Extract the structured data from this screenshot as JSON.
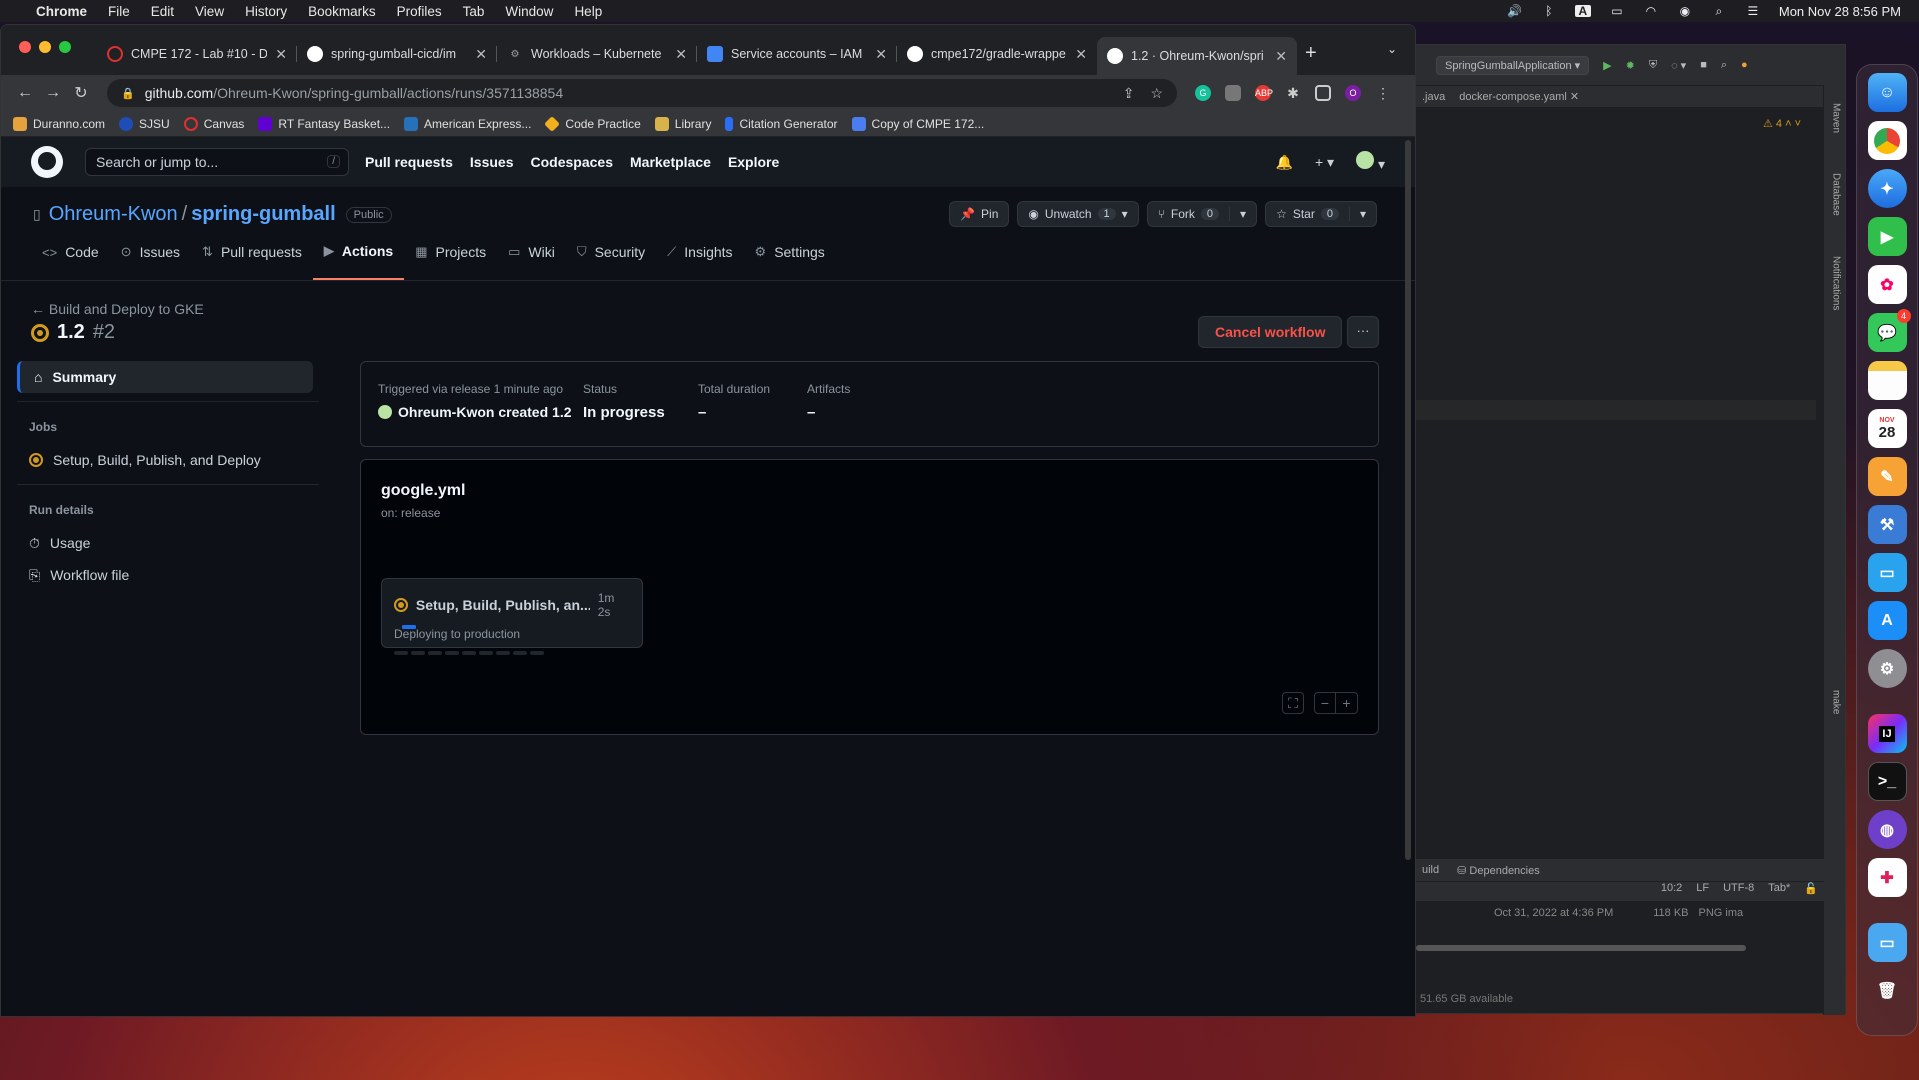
{
  "menubar": {
    "app": "Chrome",
    "items": [
      "File",
      "Edit",
      "View",
      "History",
      "Bookmarks",
      "Profiles",
      "Tab",
      "Window",
      "Help"
    ],
    "datetime": "Mon Nov 28  8:56 PM"
  },
  "browser": {
    "tabs": [
      {
        "title": "CMPE 172 - Lab #10 - D",
        "icon": "canvas-icon",
        "color": "#e0302f"
      },
      {
        "title": "spring-gumball-cicd/im",
        "icon": "github-icon",
        "color": "#ffffff"
      },
      {
        "title": "Workloads – Kubernete",
        "icon": "gear-icon",
        "color": "#9aa0a6"
      },
      {
        "title": "Service accounts – IAM",
        "icon": "shield-icon",
        "color": "#4285f4"
      },
      {
        "title": "cmpe172/gradle-wrappe",
        "icon": "github-icon",
        "color": "#ffffff"
      },
      {
        "title": "1.2 · Ohreum-Kwon/spri",
        "icon": "github-icon",
        "color": "#ffffff",
        "active": true
      }
    ],
    "url_host": "github.com",
    "url_path": "/Ohreum-Kwon/spring-gumball/actions/runs/3571138854",
    "bookmarks": [
      "Duranno.com",
      "SJSU",
      "Canvas",
      "RT Fantasy Basket...",
      "American Express...",
      "Code Practice",
      "Library",
      "Citation Generator",
      "Copy of CMPE 172..."
    ]
  },
  "github": {
    "search_placeholder": "Search or jump to...",
    "search_shortcut": "/",
    "nav": [
      "Pull requests",
      "Issues",
      "Codespaces",
      "Marketplace",
      "Explore"
    ],
    "owner": "Ohreum-Kwon",
    "repo": "spring-gumball",
    "visibility": "Public",
    "buttons": {
      "pin": "Pin",
      "unwatch": "Unwatch",
      "unwatch_count": "1",
      "fork": "Fork",
      "fork_count": "0",
      "star": "Star",
      "star_count": "0"
    },
    "tabs": [
      "Code",
      "Issues",
      "Pull requests",
      "Actions",
      "Projects",
      "Wiki",
      "Security",
      "Insights",
      "Settings"
    ],
    "active_tab": "Actions"
  },
  "run": {
    "back_label": "Build and Deploy to GKE",
    "title": "1.2",
    "number": "#2",
    "cancel_label": "Cancel workflow",
    "more_label": "···",
    "sidebar": {
      "summary": "Summary",
      "jobs_header": "Jobs",
      "job": "Setup, Build, Publish, and Deploy",
      "run_details_header": "Run details",
      "usage": "Usage",
      "workflow_file": "Workflow file"
    },
    "info": {
      "trigger_label": "Triggered via release 1 minute ago",
      "trigger_actor": "Ohreum-Kwon created 1.2",
      "status_label": "Status",
      "status_value": "In progress",
      "duration_label": "Total duration",
      "duration_value": "–",
      "artifacts_label": "Artifacts",
      "artifacts_value": "–"
    },
    "graph": {
      "workflow_file": "google.yml",
      "event": "on: release",
      "job_name": "Setup, Build, Publish, an...",
      "job_duration": "1m 2s",
      "job_status": "Deploying to production",
      "progress_fraction": 0.36
    }
  },
  "ide": {
    "run_config": "SpringGumballApplication",
    "tabs": [
      ".java",
      "docker-compose.yaml"
    ],
    "warnings": "4",
    "side_labels": [
      "Maven",
      "Database",
      "Notifications",
      "make"
    ],
    "bottom_tabs": [
      "uild",
      "Dependencies"
    ],
    "status": [
      "10:2",
      "LF",
      "UTF-8",
      "Tab*"
    ],
    "file_date": "Oct 31, 2022 at 4:36 PM",
    "file_size": "118 KB",
    "file_kind": "PNG ima",
    "disk": "51.65 GB available"
  },
  "dock": {
    "calendar_month": "NOV",
    "calendar_day": "28",
    "messages_badge": "4"
  }
}
